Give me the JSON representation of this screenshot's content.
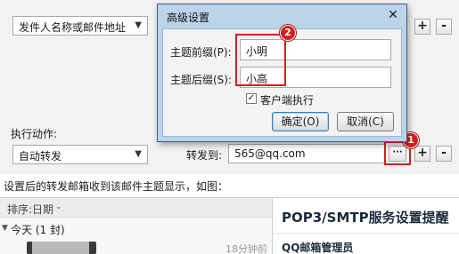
{
  "rule_editor": {
    "condition_select": "发件人名称或邮件地址",
    "action_label": "执行动作:",
    "action_select": "自动转发",
    "forward_label": "转发到:",
    "forward_value": "565@qq.com",
    "more_button": "···",
    "add_button": "+",
    "remove_button": "-"
  },
  "dialog": {
    "title": "高级设置",
    "close": "✕",
    "prefix_label": "主题前缀(P):",
    "prefix_value": "小明",
    "suffix_label": "主题后缀(S):",
    "suffix_value": "小高",
    "client_exec_label": "客户端执行",
    "client_exec_checked": true,
    "ok": "确定(O)",
    "cancel": "取消(C)"
  },
  "callouts": {
    "one": "1",
    "two": "2",
    "color": "#d32020"
  },
  "caption": "设置后的转发邮箱收到该邮件主题显示，如图：",
  "mail_list": {
    "sort_label": "排序:日期",
    "group_label": "今天 (1 封)",
    "item_time": "18分钟前"
  },
  "reading_pane": {
    "title": "POP3/SMTP服务设置提醒",
    "from": "QQ邮箱管理员"
  }
}
